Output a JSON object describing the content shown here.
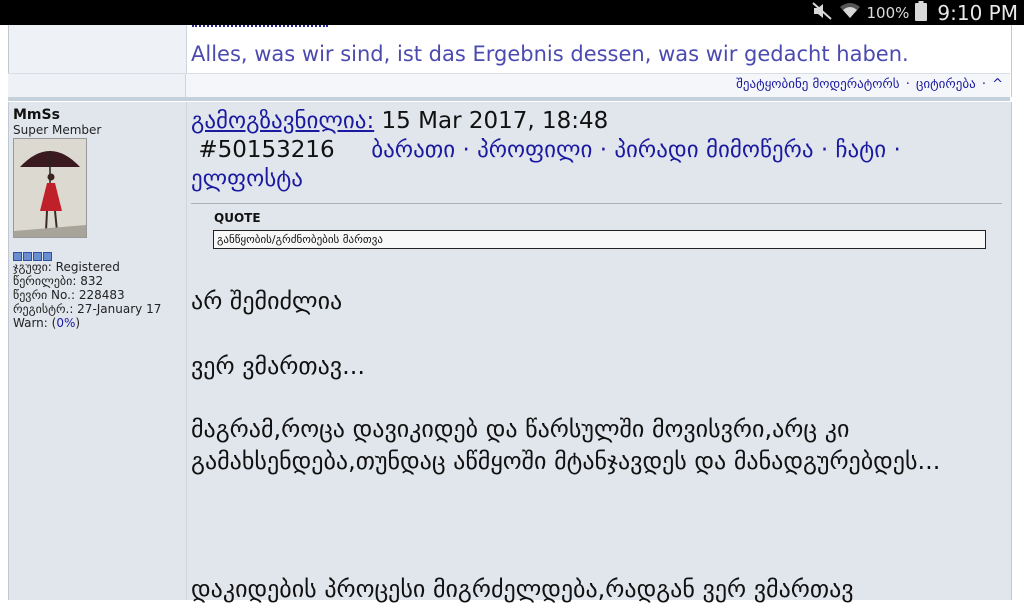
{
  "statusbar": {
    "battery_percent": "100%",
    "time": "9:10 PM",
    "icons": [
      "mute-icon",
      "wifi-icon",
      "battery-icon"
    ]
  },
  "prev_post": {
    "signature_quote": "Alles, was wir sind, ist das Ergebnis dessen, was wir gedacht haben.",
    "actions": {
      "report": "შეატყობინე მოდერატორს",
      "dot1": "·",
      "quote": "ციტირება",
      "dot2": "·",
      "top": "^"
    }
  },
  "post": {
    "user": {
      "name": "MmSs",
      "title": "Super Member",
      "group": "ჯგუფი: Registered",
      "posts": "წერილები: 832",
      "member_no": "წევრი No.: 228483",
      "registered": "რეგისტრ.: 27-January 17",
      "warn_prefix": "Warn: (",
      "warn_value": "0%",
      "warn_suffix": ")",
      "pips": 4
    },
    "header": {
      "posted_label": "გამოგზავნილია:",
      "posted_date": "15 Mar 2017, 18:48",
      "post_id": "#50153216",
      "links": {
        "card": "ბარათი",
        "sep1": "·",
        "profile": "პროფილი",
        "sep2": "·",
        "pm": "პირადი მიმოწერა",
        "sep3": "·",
        "chat": "ჩატი",
        "sep4": "·",
        "email": "ელფოსტა"
      }
    },
    "quote": {
      "label": "QUOTE",
      "text": "განწყობის/გრძნობების მართვა"
    },
    "message": {
      "p1": "არ შემიძლია",
      "p2": "ვერ ვმართავ...",
      "p3": "მაგრამ,როცა დავიკიდებ და წარსულში მოვისვრი,არც კი გამახსენდება,თუნდაც აწმყოში მტანჯავდეს და მანადგურებდეს...",
      "p4": "დაკიდების პროცესი მიგრძელდება,რადგან ვერ ვმართავ"
    }
  }
}
